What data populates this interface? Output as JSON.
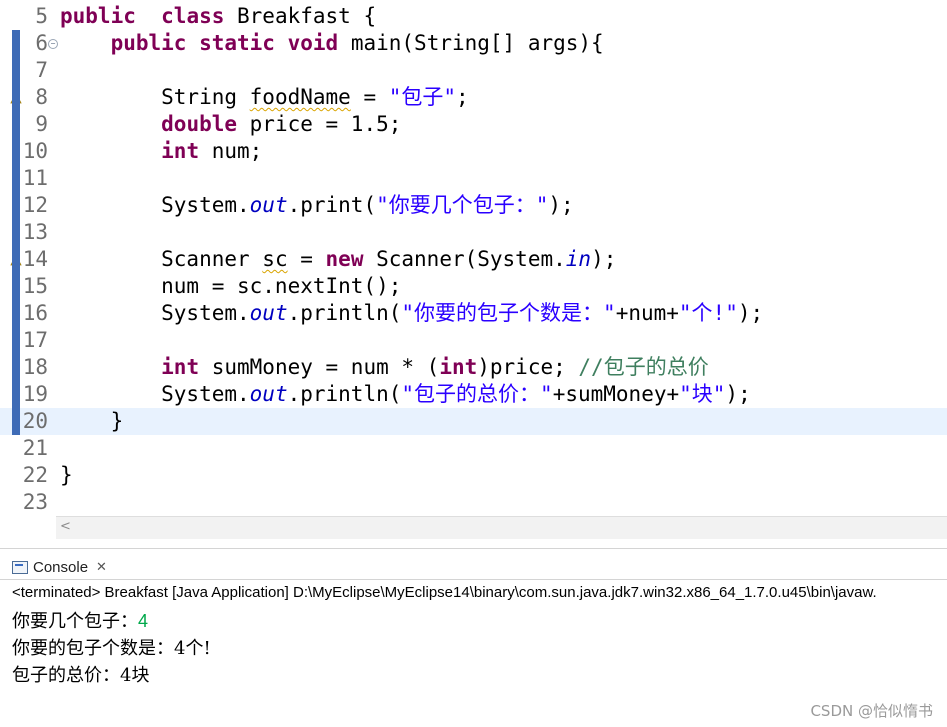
{
  "editor": {
    "lines": [
      {
        "n": "5",
        "parts": [
          [
            "kw",
            "public"
          ],
          [
            "",
            "  "
          ],
          [
            "kw",
            "class"
          ],
          [
            "",
            " Breakfast {"
          ]
        ]
      },
      {
        "n": "6",
        "parts": [
          [
            "",
            "    "
          ],
          [
            "kw",
            "public"
          ],
          [
            "",
            " "
          ],
          [
            "kw",
            "static"
          ],
          [
            "",
            " "
          ],
          [
            "kw",
            "void"
          ],
          [
            "",
            " main(String[] args){"
          ]
        ]
      },
      {
        "n": "7",
        "parts": []
      },
      {
        "n": "8",
        "parts": [
          [
            "",
            "        String "
          ],
          [
            "sq",
            "foodName"
          ],
          [
            "",
            " = "
          ],
          [
            "str",
            "\"包子\""
          ],
          [
            "",
            ";"
          ]
        ]
      },
      {
        "n": "9",
        "parts": [
          [
            "",
            "        "
          ],
          [
            "kw",
            "double"
          ],
          [
            "",
            " price = 1.5;"
          ]
        ]
      },
      {
        "n": "10",
        "parts": [
          [
            "",
            "        "
          ],
          [
            "kw",
            "int"
          ],
          [
            "",
            " num;"
          ]
        ]
      },
      {
        "n": "11",
        "parts": []
      },
      {
        "n": "12",
        "parts": [
          [
            "",
            "        System."
          ],
          [
            "it",
            "out"
          ],
          [
            "",
            ".print("
          ],
          [
            "str",
            "\"你要几个包子：\""
          ],
          [
            "",
            ");"
          ]
        ]
      },
      {
        "n": "13",
        "parts": []
      },
      {
        "n": "14",
        "parts": [
          [
            "",
            "        Scanner "
          ],
          [
            "sq",
            "sc"
          ],
          [
            "",
            " = "
          ],
          [
            "kw",
            "new"
          ],
          [
            "",
            " Scanner(System."
          ],
          [
            "it",
            "in"
          ],
          [
            "",
            ");"
          ]
        ]
      },
      {
        "n": "15",
        "parts": [
          [
            "",
            "        num = sc.nextInt();"
          ]
        ]
      },
      {
        "n": "16",
        "parts": [
          [
            "",
            "        System."
          ],
          [
            "it",
            "out"
          ],
          [
            "",
            ".println("
          ],
          [
            "str",
            "\"你要的包子个数是：\""
          ],
          [
            "",
            "+num+"
          ],
          [
            "str",
            "\"个!\""
          ],
          [
            "",
            ");"
          ]
        ]
      },
      {
        "n": "17",
        "parts": []
      },
      {
        "n": "18",
        "parts": [
          [
            "",
            "        "
          ],
          [
            "kw",
            "int"
          ],
          [
            "",
            " sumMoney = num * ("
          ],
          [
            "kw",
            "int"
          ],
          [
            "",
            ")price; "
          ],
          [
            "cm",
            "//包子的总价"
          ]
        ]
      },
      {
        "n": "19",
        "parts": [
          [
            "",
            "        System."
          ],
          [
            "it",
            "out"
          ],
          [
            "",
            ".println("
          ],
          [
            "str",
            "\"包子的总价：\""
          ],
          [
            "",
            "+sumMoney+"
          ],
          [
            "str",
            "\"块\""
          ],
          [
            "",
            ");"
          ]
        ]
      },
      {
        "n": "20",
        "parts": [
          [
            "",
            "    }"
          ]
        ]
      },
      {
        "n": "21",
        "parts": []
      },
      {
        "n": "22",
        "parts": [
          [
            "",
            "}"
          ]
        ]
      },
      {
        "n": "23",
        "parts": []
      }
    ],
    "highlighted_line": "20",
    "scroll_arrow": "<"
  },
  "console": {
    "tab_label": "Console",
    "tab_close": "✕",
    "terminated": "<terminated> Breakfast [Java Application] D:\\MyEclipse\\MyEclipse14\\binary\\com.sun.java.jdk7.win32.x86_64_1.7.0.u45\\bin\\javaw.",
    "output": [
      {
        "text": "你要几个包子：",
        "input": "4"
      },
      {
        "text": "你要的包子个数是：4个!",
        "input": ""
      },
      {
        "text": "包子的总价：4块",
        "input": ""
      }
    ]
  },
  "watermark": "CSDN @恰似惰书"
}
